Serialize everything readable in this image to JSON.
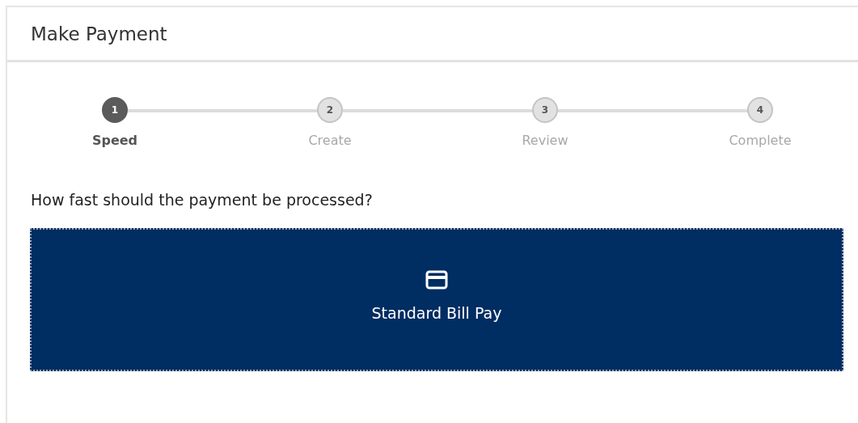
{
  "panel": {
    "title": "Make Payment"
  },
  "steps": [
    {
      "number": "1",
      "label": "Speed",
      "selected": true
    },
    {
      "number": "2",
      "label": "Create",
      "selected": false
    },
    {
      "number": "3",
      "label": "Review",
      "selected": false
    },
    {
      "number": "4",
      "label": "Complete",
      "selected": false
    }
  ],
  "question": "How fast should the payment be processed?",
  "options": [
    {
      "label": "Standard Bill Pay",
      "selected": true
    }
  ]
}
